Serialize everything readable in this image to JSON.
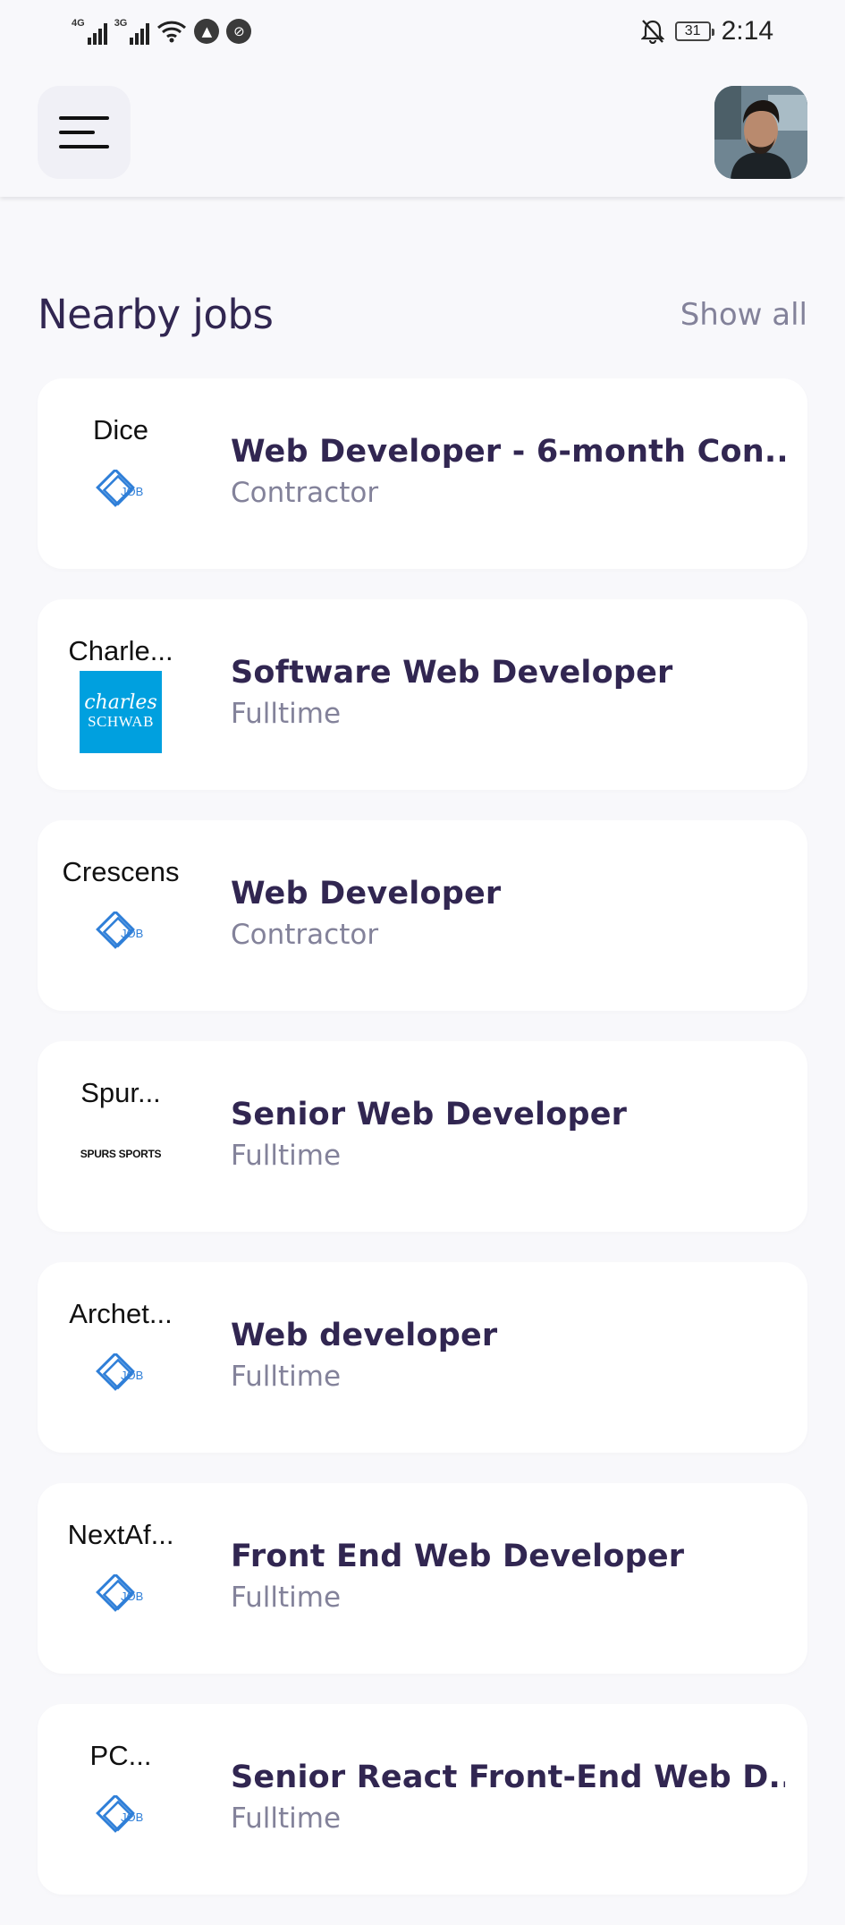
{
  "status_bar": {
    "net1": "4G",
    "net2": "3G",
    "battery": "31",
    "time": "2:14"
  },
  "header": {
    "menu_icon": "menu-icon",
    "avatar": "profile-avatar"
  },
  "section": {
    "title": "Nearby jobs",
    "show_all": "Show all"
  },
  "jobs": [
    {
      "company": "Dice",
      "title": "Web Developer - 6-month Con...",
      "type": "Contractor",
      "logo": "job-logo-icon"
    },
    {
      "company": "Charle...",
      "title": "Software Web Developer",
      "type": "Fulltime",
      "logo": "charles-schwab-logo",
      "logo_text1": "charles",
      "logo_text2": "SCHWAB"
    },
    {
      "company": "Crescens",
      "title": "Web Developer",
      "type": "Contractor",
      "logo": "job-logo-icon"
    },
    {
      "company": "Spur...",
      "title": "Senior Web Developer",
      "type": "Fulltime",
      "logo": "spurs-sports-logo",
      "logo_text": "SPURS SPORTS"
    },
    {
      "company": "Archet...",
      "title": "Web developer",
      "type": "Fulltime",
      "logo": "job-logo-icon"
    },
    {
      "company": "NextAf...",
      "title": "Front End Web Developer",
      "type": "Fulltime",
      "logo": "job-logo-icon"
    },
    {
      "company": "PC...",
      "title": "Senior React Front-End Web D...",
      "type": "Fulltime",
      "logo": "job-logo-icon"
    }
  ],
  "colors": {
    "primary": "#312651",
    "gray": "#83829a",
    "background": "#f8f8fb",
    "card": "#ffffff",
    "logo_blue": "#2f7fd8",
    "schwab_blue": "#00a0df"
  }
}
